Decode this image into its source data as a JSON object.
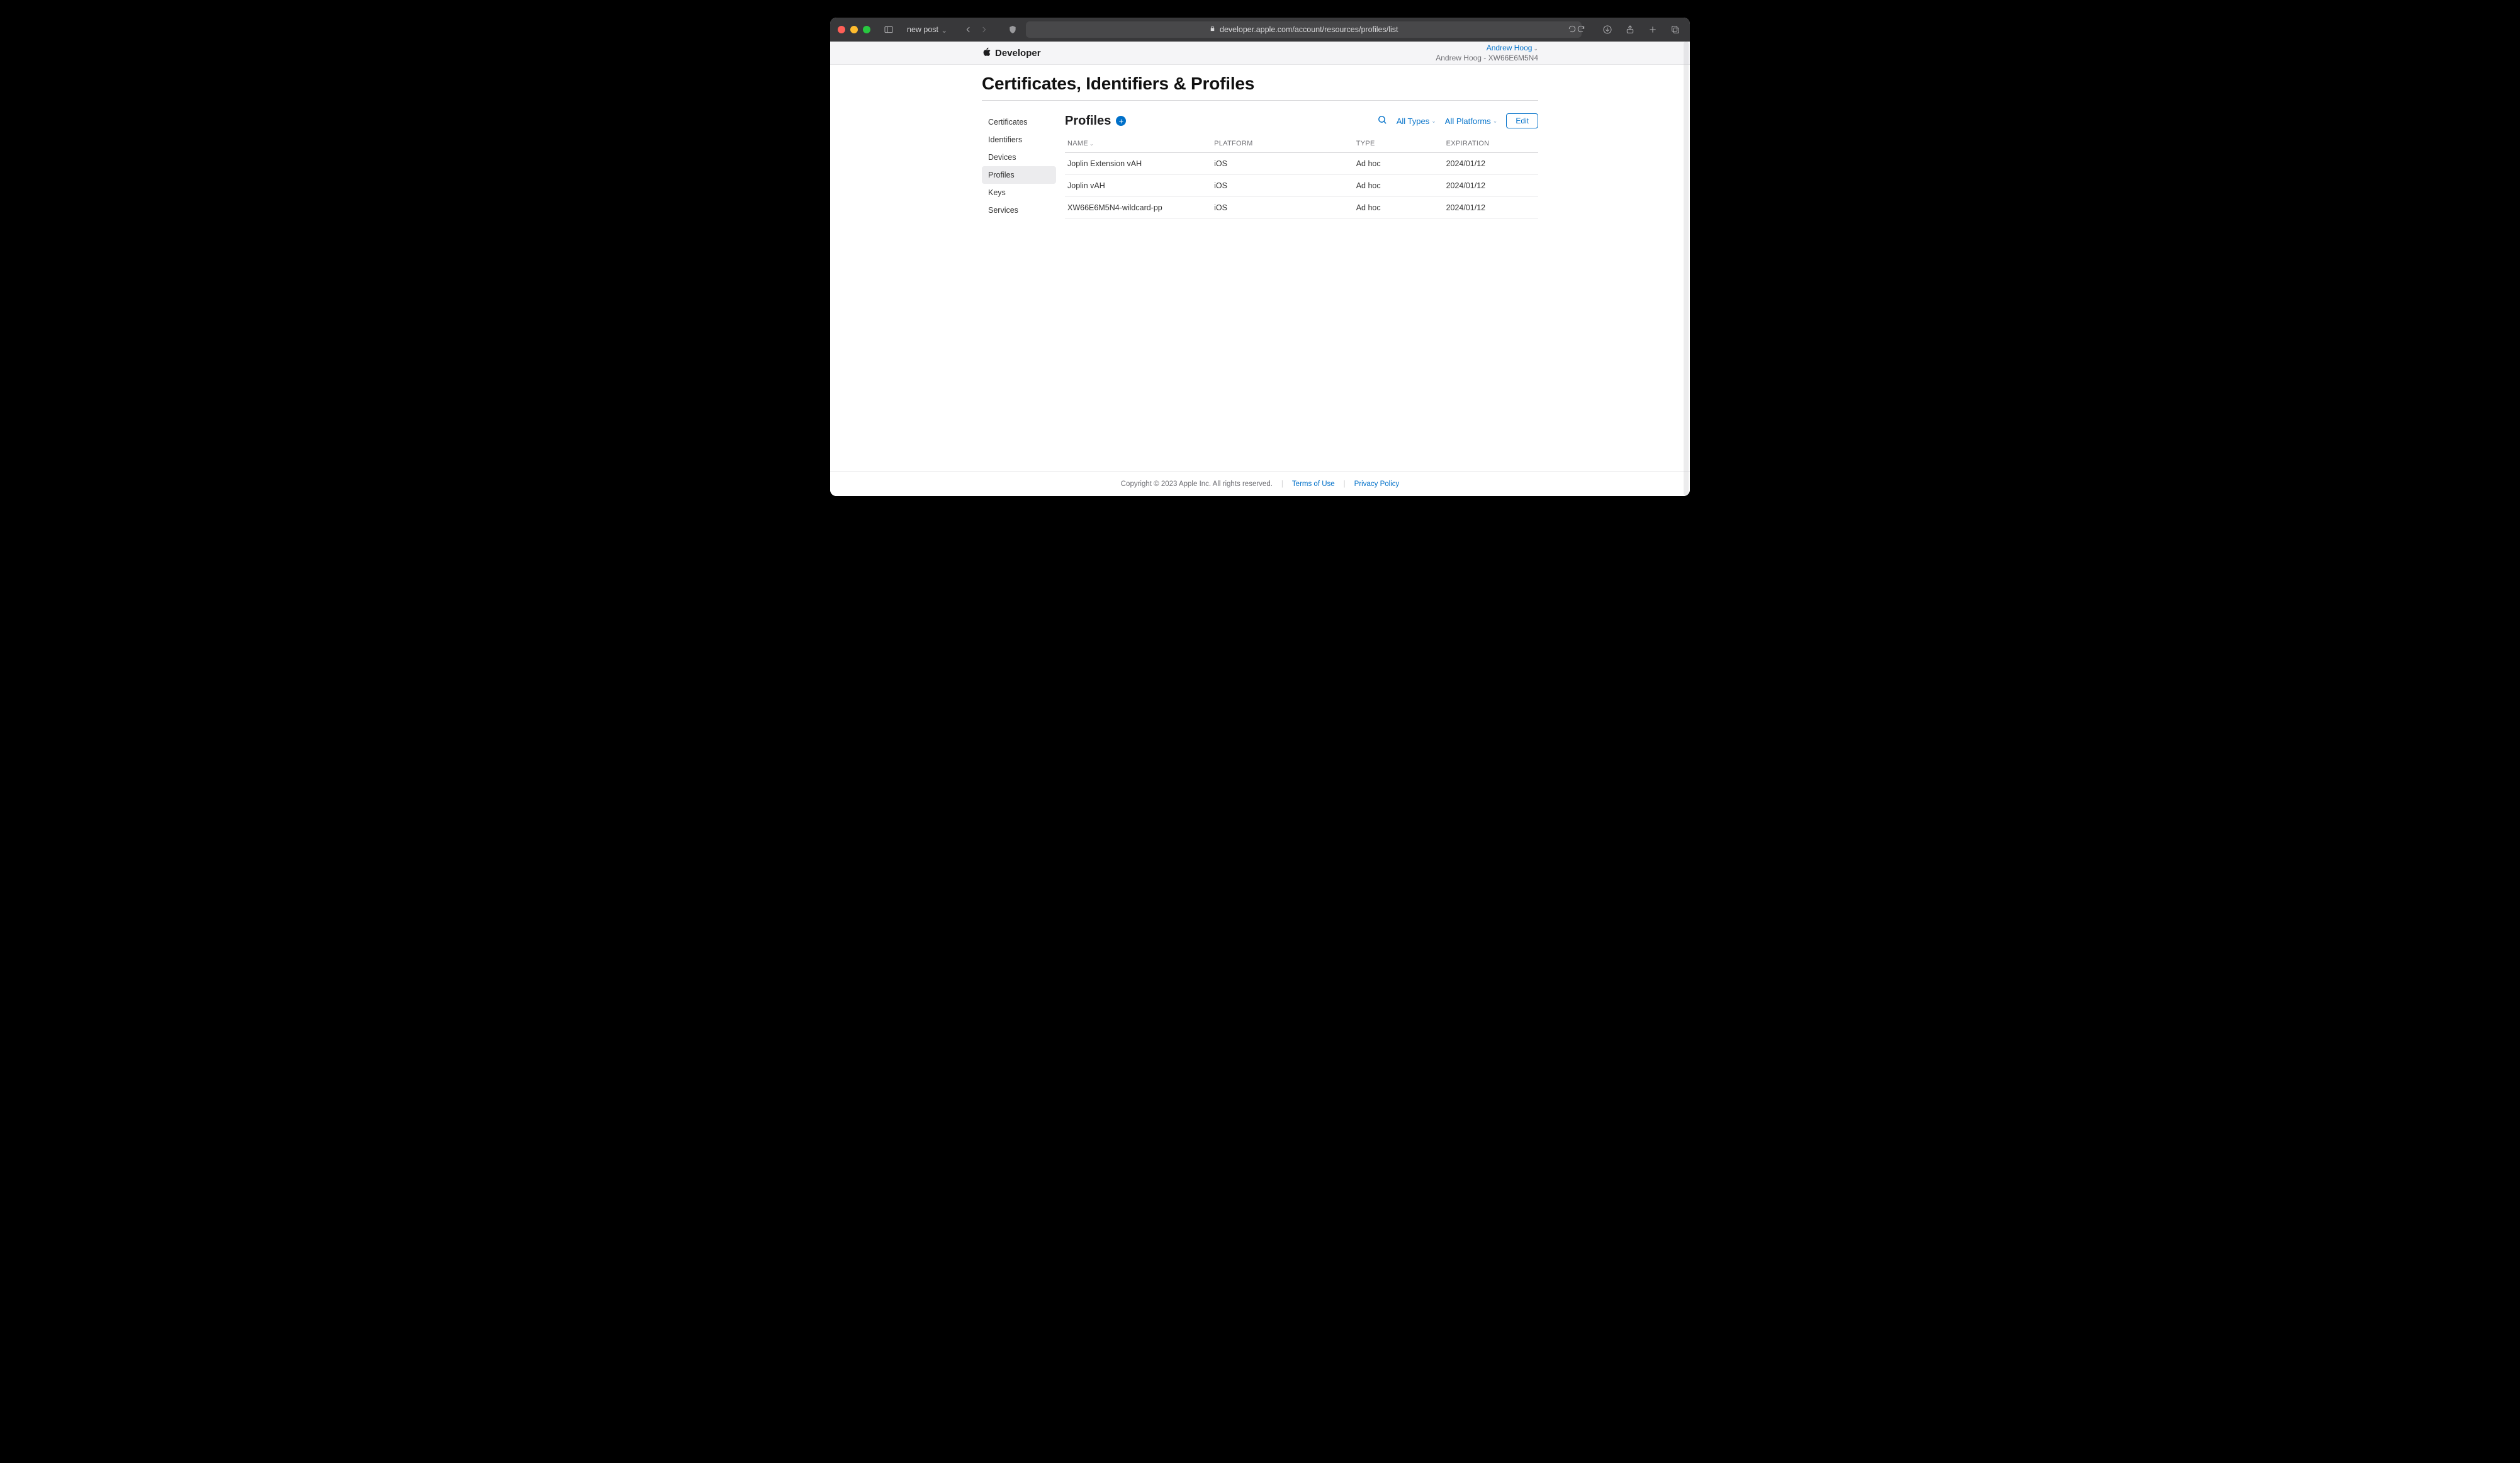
{
  "browser": {
    "tab_title": "new post",
    "url": "developer.apple.com/account/resources/profiles/list"
  },
  "header": {
    "brand": "Developer",
    "account_name": "Andrew Hoog",
    "team_line": "Andrew Hoog - XW66E6M5N4"
  },
  "page_title": "Certificates, Identifiers & Profiles",
  "sidebar": {
    "items": [
      {
        "label": "Certificates"
      },
      {
        "label": "Identifiers"
      },
      {
        "label": "Devices"
      },
      {
        "label": "Profiles"
      },
      {
        "label": "Keys"
      },
      {
        "label": "Services"
      }
    ],
    "active_index": 3
  },
  "subheader": {
    "title": "Profiles",
    "filter_types": "All Types",
    "filter_platforms": "All Platforms",
    "edit_label": "Edit"
  },
  "table": {
    "columns": [
      "NAME",
      "PLATFORM",
      "TYPE",
      "EXPIRATION"
    ],
    "rows": [
      {
        "name": "Joplin Extension vAH",
        "platform": "iOS",
        "type": "Ad hoc",
        "expiration": "2024/01/12"
      },
      {
        "name": "Joplin vAH",
        "platform": "iOS",
        "type": "Ad hoc",
        "expiration": "2024/01/12"
      },
      {
        "name": "XW66E6M5N4-wildcard-pp",
        "platform": "iOS",
        "type": "Ad hoc",
        "expiration": "2024/01/12"
      }
    ]
  },
  "footer": {
    "copyright": "Copyright © 2023 Apple Inc. All rights reserved.",
    "terms": "Terms of Use",
    "privacy": "Privacy Policy"
  }
}
